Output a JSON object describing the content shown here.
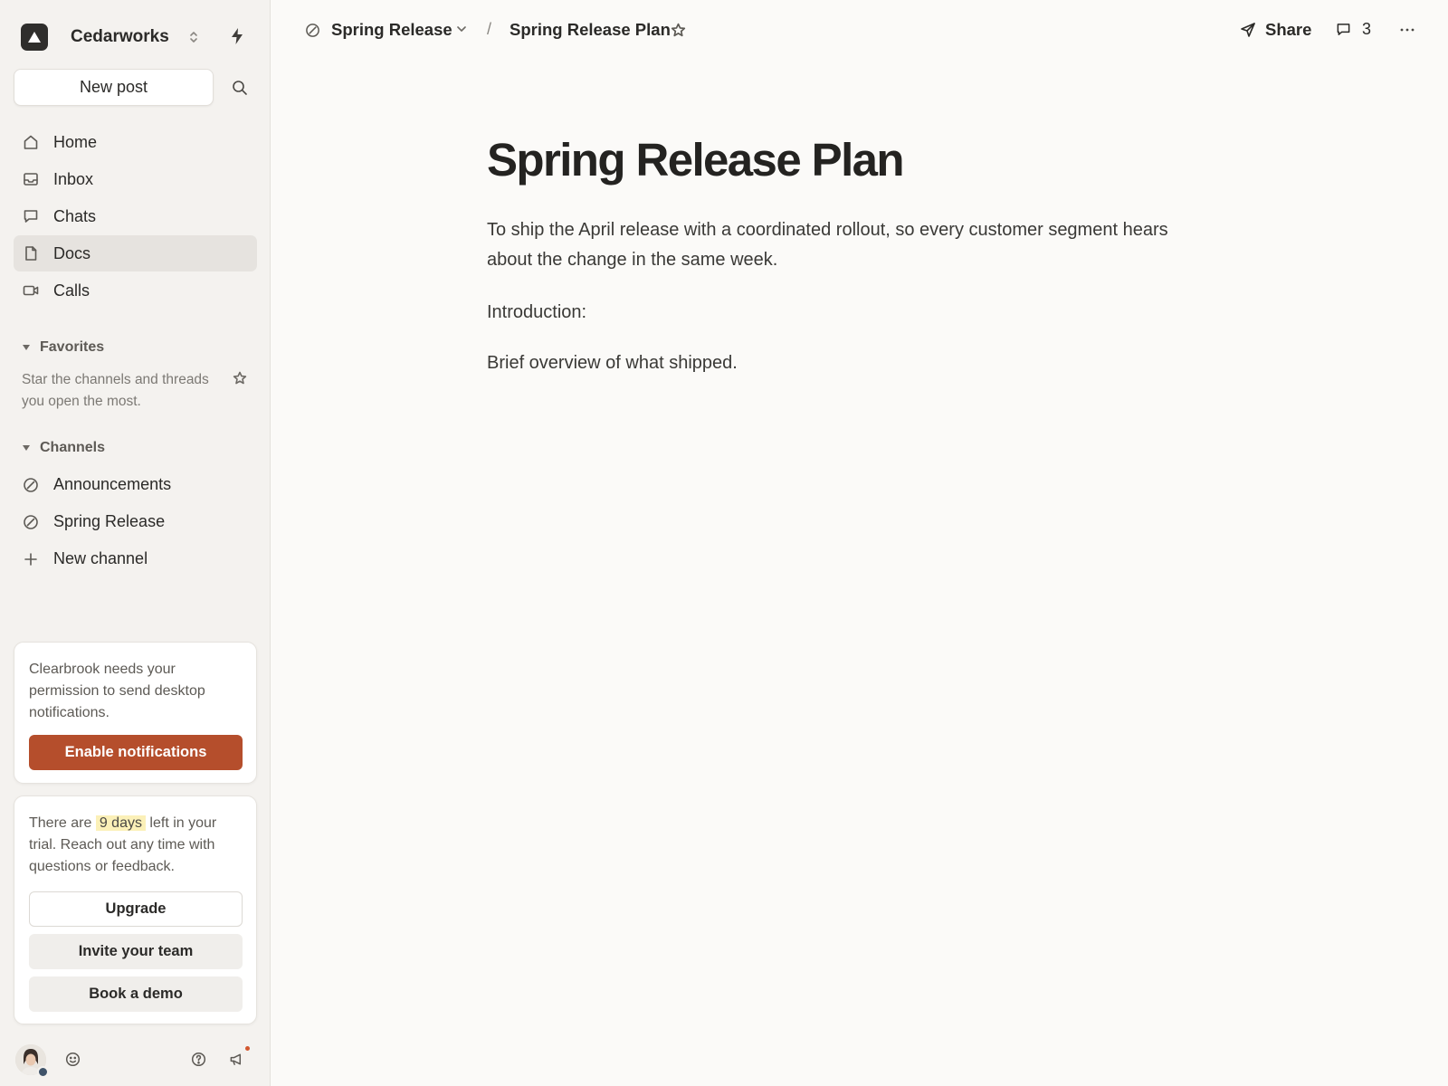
{
  "workspace": {
    "name": "Cedarworks"
  },
  "sidebar": {
    "new_post_label": "New post",
    "nav": [
      {
        "label": "Home",
        "icon": "home-icon"
      },
      {
        "label": "Inbox",
        "icon": "inbox-icon"
      },
      {
        "label": "Chats",
        "icon": "chat-icon"
      },
      {
        "label": "Docs",
        "icon": "document-icon",
        "active": true
      },
      {
        "label": "Calls",
        "icon": "video-icon"
      }
    ],
    "favorites": {
      "title": "Favorites",
      "empty_text": "Star the channels and threads you open the most."
    },
    "channels": {
      "title": "Channels",
      "items": [
        {
          "label": "Announcements",
          "icon": "channel-icon"
        },
        {
          "label": "Spring Release",
          "icon": "channel-icon"
        },
        {
          "label": "New channel",
          "icon": "plus-icon"
        }
      ]
    },
    "notification_card": {
      "text": "Clearbrook needs your permission to send desktop notifications.",
      "button_label": "Enable notifications",
      "button_color": "#b54e2c"
    },
    "trial_card": {
      "text_before": "There are",
      "highlight": "9 days",
      "text_after": "left in your trial. Reach out any time with questions or feedback.",
      "upgrade_label": "Upgrade",
      "invite_label": "Invite your team",
      "demo_label": "Book a demo"
    }
  },
  "header": {
    "breadcrumb_channel": "Spring Release",
    "breadcrumb_separator": "/",
    "breadcrumb_doc": "Spring Release Plan",
    "share_label": "Share",
    "comment_count": "3"
  },
  "document": {
    "title": "Spring Release Plan",
    "paragraphs": [
      "To ship the April release with a coordinated rollout, so every customer segment hears about the change in the same week.",
      "Introduction:",
      "Brief overview of what shipped."
    ]
  },
  "colors": {
    "accent": "#b54e2c",
    "sidebar_bg": "#f4f2ef",
    "page_bg": "#fbfaf8",
    "highlight": "#fbf0b8"
  }
}
